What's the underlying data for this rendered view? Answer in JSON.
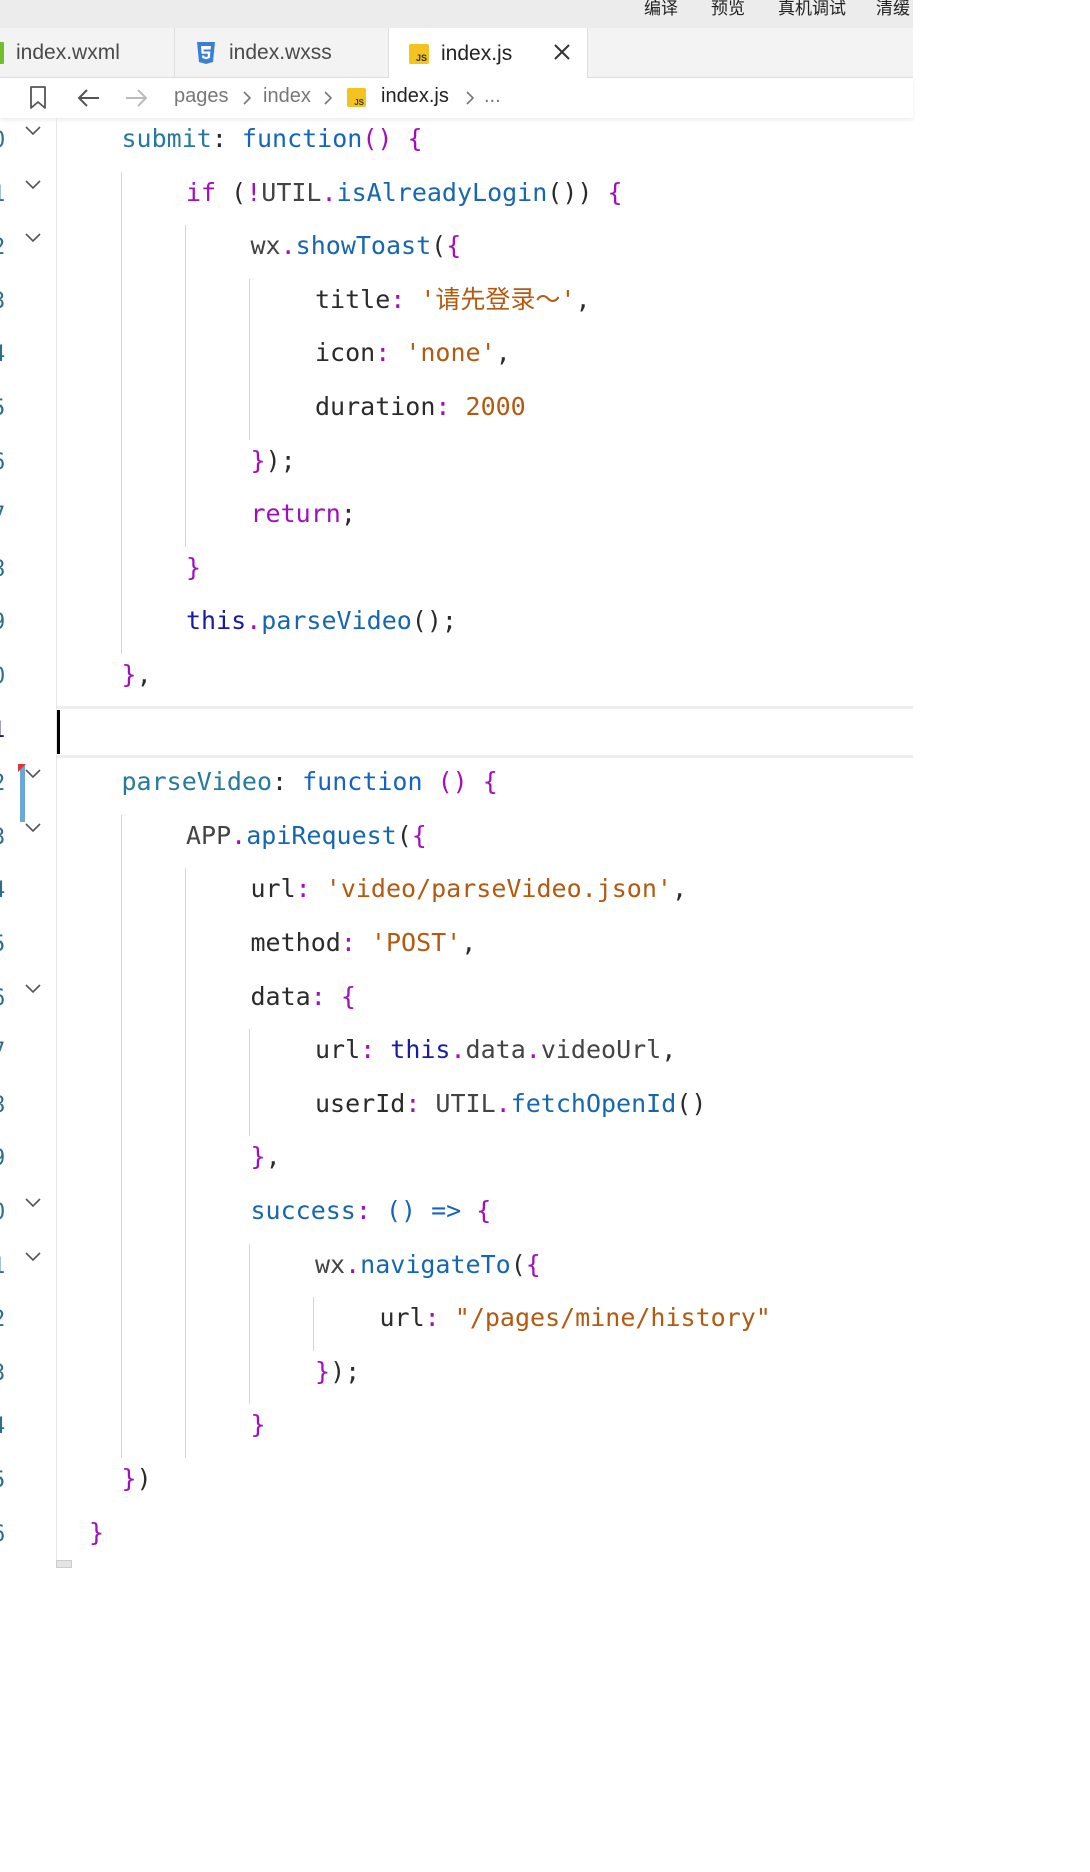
{
  "toolbar": {
    "items": [
      "编译",
      "预览",
      "真机调试",
      "清缓"
    ]
  },
  "tabs": [
    {
      "label": "index.wxml",
      "icon": "wxml-file-icon",
      "active": false
    },
    {
      "label": "index.wxss",
      "icon": "css-file-icon",
      "active": false
    },
    {
      "label": "index.js",
      "icon": "js-file-icon",
      "active": true
    }
  ],
  "breadcrumbs": {
    "items": [
      "pages",
      "index",
      "index.js",
      "..."
    ]
  },
  "editor": {
    "line_numbers": [
      "0",
      "1",
      "2",
      "3",
      "4",
      "5",
      "6",
      "7",
      "8",
      "9",
      "0",
      "1",
      "2",
      "3",
      "4",
      "5",
      "6",
      "7",
      "8",
      "9",
      "0",
      "1",
      "2",
      "3",
      "4",
      "5",
      "6"
    ],
    "current_line_index": 11,
    "fold_lines": [
      0,
      1,
      2,
      12,
      13,
      16,
      20,
      21
    ],
    "lines": [
      {
        "indent": 1,
        "tokens": [
          [
            "p",
            "submit"
          ],
          [
            "o",
            ": "
          ],
          [
            "cn",
            "function"
          ],
          [
            "k",
            "() {"
          ]
        ]
      },
      {
        "indent": 2,
        "tokens": [
          [
            "k",
            "if"
          ],
          [
            "o",
            " ("
          ],
          [
            "k",
            "!"
          ],
          [
            "u",
            "UTIL"
          ],
          [
            "k",
            "."
          ],
          [
            "f",
            "isAlreadyLogin"
          ],
          [
            "o",
            "()) "
          ],
          [
            "k",
            "{"
          ]
        ]
      },
      {
        "indent": 3,
        "tokens": [
          [
            "u",
            "wx"
          ],
          [
            "k",
            "."
          ],
          [
            "f",
            "showToast"
          ],
          [
            "o",
            "("
          ],
          [
            "k",
            "{"
          ]
        ]
      },
      {
        "indent": 4,
        "tokens": [
          [
            "o",
            "title"
          ],
          [
            "k",
            ": "
          ],
          [
            "s",
            "'请先登录～'"
          ],
          [
            "o",
            ","
          ]
        ]
      },
      {
        "indent": 4,
        "tokens": [
          [
            "o",
            "icon"
          ],
          [
            "k",
            ": "
          ],
          [
            "s",
            "'none'"
          ],
          [
            "o",
            ","
          ]
        ]
      },
      {
        "indent": 4,
        "tokens": [
          [
            "o",
            "duration"
          ],
          [
            "k",
            ": "
          ],
          [
            "n",
            "2000"
          ]
        ]
      },
      {
        "indent": 3,
        "tokens": [
          [
            "k",
            "}"
          ],
          [
            "o",
            ");"
          ]
        ]
      },
      {
        "indent": 3,
        "tokens": [
          [
            "k",
            "return"
          ],
          [
            "o",
            ";"
          ]
        ]
      },
      {
        "indent": 2,
        "tokens": [
          [
            "k",
            "}"
          ]
        ]
      },
      {
        "indent": 2,
        "tokens": [
          [
            "t",
            "this"
          ],
          [
            "k",
            "."
          ],
          [
            "f",
            "parseVideo"
          ],
          [
            "o",
            "();"
          ]
        ]
      },
      {
        "indent": 1,
        "tokens": [
          [
            "k",
            "}"
          ],
          [
            "o",
            ","
          ]
        ]
      },
      {
        "indent": 0,
        "tokens": []
      },
      {
        "indent": 1,
        "tokens": [
          [
            "p",
            "parseVideo"
          ],
          [
            "o",
            ": "
          ],
          [
            "cn",
            "function"
          ],
          [
            "k",
            " () {"
          ]
        ]
      },
      {
        "indent": 2,
        "tokens": [
          [
            "u",
            "APP"
          ],
          [
            "k",
            "."
          ],
          [
            "f",
            "apiRequest"
          ],
          [
            "o",
            "("
          ],
          [
            "k",
            "{"
          ]
        ]
      },
      {
        "indent": 3,
        "tokens": [
          [
            "o",
            "url"
          ],
          [
            "k",
            ": "
          ],
          [
            "s",
            "'video/parseVideo.json'"
          ],
          [
            "o",
            ","
          ]
        ]
      },
      {
        "indent": 3,
        "tokens": [
          [
            "o",
            "method"
          ],
          [
            "k",
            ": "
          ],
          [
            "s",
            "'POST'"
          ],
          [
            "o",
            ","
          ]
        ]
      },
      {
        "indent": 3,
        "tokens": [
          [
            "o",
            "data"
          ],
          [
            "k",
            ": {"
          ]
        ]
      },
      {
        "indent": 4,
        "tokens": [
          [
            "o",
            "url"
          ],
          [
            "k",
            ": "
          ],
          [
            "t",
            "this"
          ],
          [
            "k",
            "."
          ],
          [
            "u",
            "data"
          ],
          [
            "k",
            "."
          ],
          [
            "u",
            "videoUrl"
          ],
          [
            "o",
            ","
          ]
        ]
      },
      {
        "indent": 4,
        "tokens": [
          [
            "o",
            "userId"
          ],
          [
            "k",
            ": "
          ],
          [
            "u",
            "UTIL"
          ],
          [
            "k",
            "."
          ],
          [
            "f",
            "fetchOpenId"
          ],
          [
            "o",
            "()"
          ]
        ]
      },
      {
        "indent": 3,
        "tokens": [
          [
            "k",
            "}"
          ],
          [
            "o",
            ","
          ]
        ]
      },
      {
        "indent": 3,
        "tokens": [
          [
            "f",
            "success"
          ],
          [
            "k",
            ": "
          ],
          [
            "cn",
            "() => "
          ],
          [
            "k",
            "{"
          ]
        ]
      },
      {
        "indent": 4,
        "tokens": [
          [
            "u",
            "wx"
          ],
          [
            "k",
            "."
          ],
          [
            "f",
            "navigateTo"
          ],
          [
            "o",
            "("
          ],
          [
            "k",
            "{"
          ]
        ]
      },
      {
        "indent": 5,
        "tokens": [
          [
            "o",
            "url"
          ],
          [
            "k",
            ": "
          ],
          [
            "s",
            "\"/pages/mine/history\""
          ]
        ]
      },
      {
        "indent": 4,
        "tokens": [
          [
            "k",
            "}"
          ],
          [
            "o",
            ");"
          ]
        ]
      },
      {
        "indent": 3,
        "tokens": [
          [
            "k",
            "}"
          ]
        ]
      },
      {
        "indent": 1,
        "tokens": [
          [
            "k",
            "}"
          ],
          [
            "o",
            ")"
          ]
        ]
      },
      {
        "indent": 0.5,
        "tokens": [
          [
            "k",
            "}"
          ]
        ]
      }
    ]
  }
}
